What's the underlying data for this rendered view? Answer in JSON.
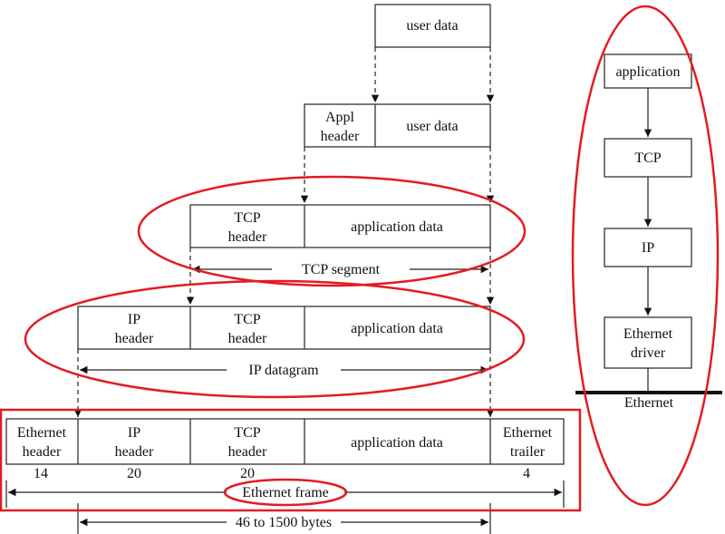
{
  "colors": {
    "annotation": "#e31b23",
    "lines": "#222222"
  },
  "encapsulation": {
    "user_data_row": {
      "user_data": "user data"
    },
    "appl_row": {
      "appl_header_1": "Appl",
      "appl_header_2": "header",
      "user_data": "user data"
    },
    "tcp_row": {
      "tcp_header_1": "TCP",
      "tcp_header_2": "header",
      "app_data": "application data",
      "span_label": "TCP segment"
    },
    "ip_row": {
      "ip_header_1": "IP",
      "ip_header_2": "header",
      "tcp_header_1": "TCP",
      "tcp_header_2": "header",
      "app_data": "application data",
      "span_label": "IP datagram"
    },
    "ethernet_row": {
      "eth_header_1": "Ethernet",
      "eth_header_2": "header",
      "ip_header_1": "IP",
      "ip_header_2": "header",
      "tcp_header_1": "TCP",
      "tcp_header_2": "header",
      "app_data": "application data",
      "eth_trailer_1": "Ethernet",
      "eth_trailer_2": "trailer",
      "sizes": [
        "14",
        "20",
        "20",
        "4"
      ],
      "frame_label": "Ethernet frame",
      "payload_label": "46 to 1500 bytes"
    }
  },
  "stack": {
    "layers": [
      "application",
      "TCP",
      "IP"
    ],
    "driver_1": "Ethernet",
    "driver_2": "driver",
    "medium": "Ethernet"
  }
}
